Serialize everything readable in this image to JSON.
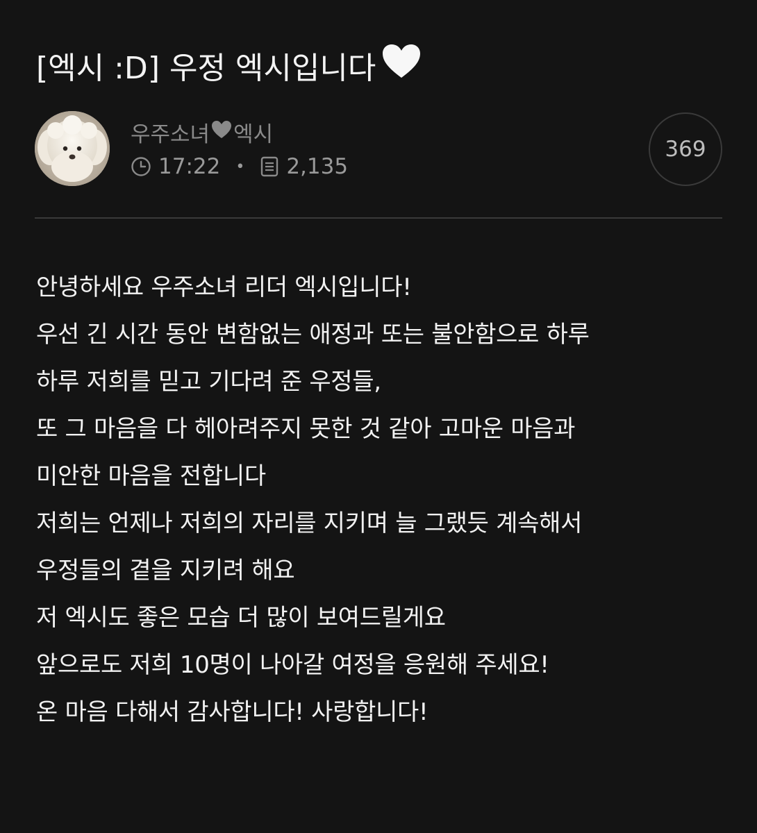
{
  "post": {
    "title": "[엑시 :D] 우정 엑시입니다",
    "title_icon": "white-heart-icon",
    "author": {
      "name_before": "우주소녀",
      "name_icon": "heart-icon",
      "name_after": "엑시",
      "avatar": "white-poodle-avatar"
    },
    "meta": {
      "time": "17:22",
      "time_icon": "clock-icon",
      "views": "2,135",
      "views_icon": "document-icon"
    },
    "comment_count": "369",
    "body_lines": [
      "안녕하세요 우주소녀 리더 엑시입니다!",
      "우선 긴 시간 동안 변함없는 애정과 또는 불안함으로 하루",
      "하루 저희를 믿고 기다려 준 우정들,",
      "또 그 마음을 다 헤아려주지 못한 것 같아 고마운 마음과",
      "미안한 마음을 전합니다",
      "저희는 언제나 저희의 자리를 지키며 늘 그랬듯 계속해서",
      "우정들의 곁을 지키려 해요",
      "저 엑시도 좋은 모습 더 많이 보여드릴게요",
      "앞으로도 저희 10명이 나아갈 여정을 응원해 주세요!",
      "온 마음 다해서 감사합니다! 사랑합니다!"
    ]
  },
  "colors": {
    "background": "#141414",
    "text": "#f2f2f2",
    "muted": "#8a8a8a",
    "border": "#3a3a3a"
  }
}
